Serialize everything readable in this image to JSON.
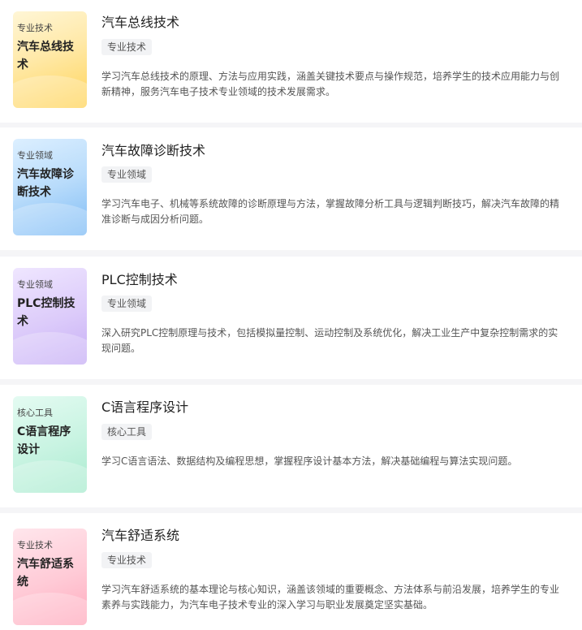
{
  "courses": [
    {
      "thumb_tag": "专业技术",
      "thumb_title": "汽车总线技术",
      "title": "汽车总线技术",
      "badge": "专业技术",
      "description": "学习汽车总线技术的原理、方法与应用实践，涵盖关键技术要点与操作规范，培养学生的技术应用能力与创新精神，服务汽车电子技术专业领域的技术发展需求。",
      "color": "#ffd45a"
    },
    {
      "thumb_tag": "专业领域",
      "thumb_title": "汽车故障诊断技术",
      "title": "汽车故障诊断技术",
      "badge": "专业领域",
      "description": "学习汽车电子、机械等系统故障的诊断原理与方法，掌握故障分析工具与逻辑判断技巧，解决汽车故障的精准诊断与成因分析问题。",
      "color": "#7fbcf5"
    },
    {
      "thumb_tag": "专业领域",
      "thumb_title": "PLC控制技术",
      "title": "PLC控制技术",
      "badge": "专业领域",
      "description": "深入研究PLC控制原理与技术，包括模拟量控制、运动控制及系统优化，解决工业生产中复杂控制需求的实现问题。",
      "color": "#c6aef5"
    },
    {
      "thumb_tag": "核心工具",
      "thumb_title": "C语言程序设计",
      "title": "C语言程序设计",
      "badge": "核心工具",
      "description": "学习C语言语法、数据结构及编程思想，掌握程序设计基本方法，解决基础编程与算法实现问题。",
      "color": "#a9ebcf"
    },
    {
      "thumb_tag": "专业技术",
      "thumb_title": "汽车舒适系统",
      "title": "汽车舒适系统",
      "badge": "专业技术",
      "description": "学习汽车舒适系统的基本理论与核心知识，涵盖该领域的重要概念、方法体系与前沿发展，培养学生的专业素养与实践能力，为汽车电子技术专业的深入学习与职业发展奠定坚实基础。",
      "color": "#ffaabd"
    }
  ]
}
